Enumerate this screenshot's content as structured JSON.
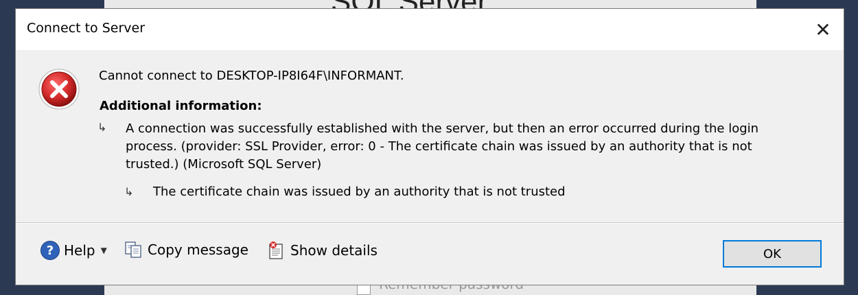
{
  "background": {
    "app_title": "SQL Server",
    "checkbox_label": "Remember password"
  },
  "dialog": {
    "title": "Connect to Server",
    "close_glyph": "✕",
    "message": "Cannot connect to DESKTOP-IP8I64F\\INFORMANT.",
    "additional_info_heading": "Additional information:",
    "arrow_glyph": "↳",
    "detail_primary": "A connection was successfully established with the server, but then an error occurred during the login process. (provider: SSL Provider, error: 0 - The certificate chain was issued by an authority that is not trusted.) (Microsoft SQL Server)",
    "detail_inner": "The certificate chain was issued by an authority that is not trusted",
    "icon": "error-icon"
  },
  "footer": {
    "help_label": "Help",
    "help_icon_glyph": "?",
    "dropdown_glyph": "▼",
    "copy_label": "Copy message",
    "details_label": "Show details",
    "ok_label": "OK"
  },
  "colors": {
    "accent": "#0078d7",
    "error_red": "#d42b2b",
    "dialog_bg": "#f0f0f0"
  }
}
